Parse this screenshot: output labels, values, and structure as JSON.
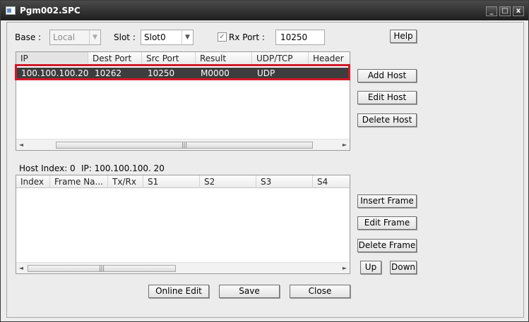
{
  "window": {
    "title": "Pgm002.SPC",
    "minimize_glyph": "_",
    "maximize_glyph": "□",
    "close_glyph": "x"
  },
  "top": {
    "base_label": "Base :",
    "base_value": "Local",
    "slot_label": "Slot :",
    "slot_value": "Slot0",
    "rx_checked": true,
    "rx_label": "Rx Port :",
    "rx_port_value": "10250",
    "help_label": "Help"
  },
  "hosts": {
    "columns": [
      "IP",
      "Dest Port",
      "Src Port",
      "Result",
      "UDP/TCP",
      "Header"
    ],
    "rows": [
      {
        "ip": "100.100.100.20",
        "dest_port": "10262",
        "src_port": "10250",
        "result": "M0000",
        "protocol": "UDP",
        "header": ""
      }
    ],
    "add_label": "Add Host",
    "edit_label": "Edit Host",
    "delete_label": "Delete Host"
  },
  "host_info": {
    "index_text": "Host Index: 0",
    "ip_text": "IP: 100.100.100. 20"
  },
  "frames": {
    "columns": [
      "Index",
      "Frame Na...",
      "Tx/Rx",
      "S1",
      "S2",
      "S3",
      "S4"
    ],
    "insert_label": "Insert Frame",
    "edit_label": "Edit Frame",
    "delete_label": "Delete Frame",
    "up_label": "Up",
    "down_label": "Down"
  },
  "footer": {
    "online_edit_label": "Online Edit",
    "save_label": "Save",
    "close_label": "Close"
  },
  "scroll": {
    "left_glyph": "◄",
    "right_glyph": "►",
    "thumb_grip": "|||"
  },
  "colors": {
    "selected_row": "#3d3d3d",
    "highlight_border": "#d0192a",
    "titlebar": "#2b2b2b"
  }
}
